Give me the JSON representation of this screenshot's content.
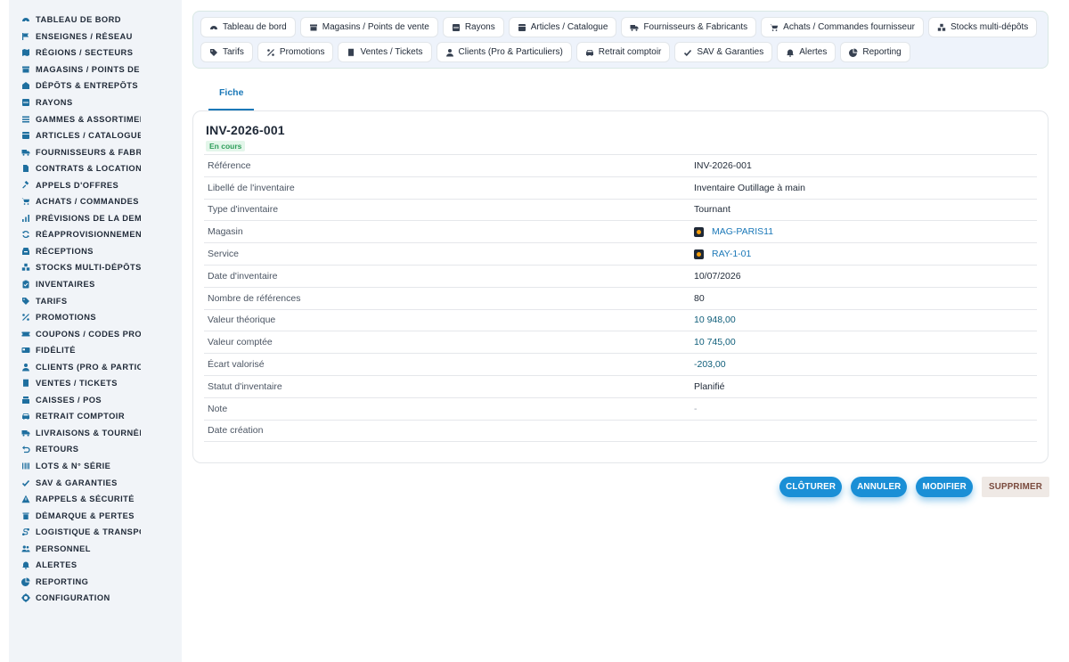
{
  "colors": {
    "accent": "#1a78b8",
    "button": "#1a8fd6",
    "badge_bg": "#e3f6ea",
    "badge_text": "#2d9d59",
    "danger_bg": "#efe9e5"
  },
  "sidebar": {
    "items": [
      {
        "label": "TABLEAU DE BORD",
        "icon": "dashboard-icon"
      },
      {
        "label": "ENSEIGNES / RÉSEAU",
        "icon": "flag-icon"
      },
      {
        "label": "RÉGIONS / SECTEURS",
        "icon": "map-icon"
      },
      {
        "label": "MAGASINS / POINTS DE VENTE",
        "icon": "store-icon"
      },
      {
        "label": "DÉPÔTS & ENTREPÔTS",
        "icon": "warehouse-icon"
      },
      {
        "label": "RAYONS",
        "icon": "shelf-icon"
      },
      {
        "label": "GAMMES & ASSORTIMENTS",
        "icon": "list-icon"
      },
      {
        "label": "ARTICLES / CATALOGUE",
        "icon": "grid-icon"
      },
      {
        "label": "FOURNISSEURS & FABRICANTS",
        "icon": "truck-icon"
      },
      {
        "label": "CONTRATS & LOCATION",
        "icon": "document-icon"
      },
      {
        "label": "APPELS D'OFFRES",
        "icon": "gavel-icon"
      },
      {
        "label": "ACHATS / COMMANDES FOURNISSEUR",
        "icon": "cart-icon"
      },
      {
        "label": "PRÉVISIONS DE LA DEMANDE",
        "icon": "chart-icon"
      },
      {
        "label": "RÉAPPROVISIONNEMENT",
        "icon": "refresh-icon"
      },
      {
        "label": "RÉCEPTIONS",
        "icon": "inbox-icon"
      },
      {
        "label": "STOCKS MULTI-DÉPÔTS",
        "icon": "boxes-icon"
      },
      {
        "label": "INVENTAIRES",
        "icon": "clipboard-icon"
      },
      {
        "label": "TARIFS",
        "icon": "tag-icon"
      },
      {
        "label": "PROMOTIONS",
        "icon": "percent-icon"
      },
      {
        "label": "COUPONS / CODES PROMO",
        "icon": "ticket-icon"
      },
      {
        "label": "FIDÉLITÉ",
        "icon": "card-icon"
      },
      {
        "label": "CLIENTS (PRO & PARTICULIERS)",
        "icon": "user-icon"
      },
      {
        "label": "VENTES / TICKETS",
        "icon": "receipt-icon"
      },
      {
        "label": "CAISSES / POS",
        "icon": "register-icon"
      },
      {
        "label": "RETRAIT COMPTOIR",
        "icon": "car-icon"
      },
      {
        "label": "LIVRAISONS & TOURNÉES",
        "icon": "delivery-icon"
      },
      {
        "label": "RETOURS",
        "icon": "undo-icon"
      },
      {
        "label": "LOTS & N° SÉRIE",
        "icon": "barcode-icon"
      },
      {
        "label": "SAV & GARANTIES",
        "icon": "check-shield-icon"
      },
      {
        "label": "RAPPELS & SÉCURITÉ",
        "icon": "warning-icon"
      },
      {
        "label": "DÉMARQUE & PERTES",
        "icon": "trash-icon"
      },
      {
        "label": "LOGISTIQUE & TRANSPORT",
        "icon": "route-icon"
      },
      {
        "label": "PERSONNEL",
        "icon": "users-icon"
      },
      {
        "label": "ALERTES",
        "icon": "bell-icon"
      },
      {
        "label": "REPORTING",
        "icon": "pie-icon"
      },
      {
        "label": "CONFIGURATION",
        "icon": "gear-icon"
      }
    ]
  },
  "topnav": {
    "chips": [
      {
        "label": "Tableau de bord",
        "icon": "dashboard-icon"
      },
      {
        "label": "Magasins / Points de vente",
        "icon": "store-icon"
      },
      {
        "label": "Rayons",
        "icon": "shelf-icon"
      },
      {
        "label": "Articles / Catalogue",
        "icon": "grid-icon"
      },
      {
        "label": "Fournisseurs & Fabricants",
        "icon": "truck-icon"
      },
      {
        "label": "Achats / Commandes fournisseur",
        "icon": "cart-icon"
      },
      {
        "label": "Stocks multi-dépôts",
        "icon": "boxes-icon"
      },
      {
        "label": "Tarifs",
        "icon": "tag-icon"
      },
      {
        "label": "Promotions",
        "icon": "percent-icon"
      },
      {
        "label": "Ventes / Tickets",
        "icon": "receipt-icon"
      },
      {
        "label": "Clients (Pro & Particuliers)",
        "icon": "user-icon"
      },
      {
        "label": "Retrait comptoir",
        "icon": "car-icon"
      },
      {
        "label": "SAV & Garanties",
        "icon": "check-shield-icon"
      },
      {
        "label": "Alertes",
        "icon": "bell-icon"
      },
      {
        "label": "Reporting",
        "icon": "pie-icon"
      }
    ]
  },
  "tabs": {
    "fiche": "Fiche"
  },
  "record": {
    "title": "INV-2026-001",
    "status_badge": "En cours",
    "fields": [
      {
        "key": "Référence",
        "value": "INV-2026-001",
        "kind": "text"
      },
      {
        "key": "Libellé de l'inventaire",
        "value": "Inventaire Outillage à main",
        "kind": "text"
      },
      {
        "key": "Type d'inventaire",
        "value": "Tournant",
        "kind": "text"
      },
      {
        "key": "Magasin",
        "value": "MAG-PARIS11",
        "kind": "link"
      },
      {
        "key": "Service",
        "value": "RAY-1-01",
        "kind": "link"
      },
      {
        "key": "Date d'inventaire",
        "value": "10/07/2026",
        "kind": "text"
      },
      {
        "key": "Nombre de références",
        "value": "80",
        "kind": "text"
      },
      {
        "key": "Valeur théorique",
        "value": "10 948,00",
        "kind": "num"
      },
      {
        "key": "Valeur comptée",
        "value": "10 745,00",
        "kind": "num"
      },
      {
        "key": "Écart valorisé",
        "value": "-203,00",
        "kind": "num"
      },
      {
        "key": "Statut d'inventaire",
        "value": "Planifié",
        "kind": "text"
      },
      {
        "key": "Note",
        "value": "-",
        "kind": "muted"
      },
      {
        "key": "Date création",
        "value": "",
        "kind": "text"
      }
    ]
  },
  "actions": {
    "close": "CLÔTURER",
    "cancel": "ANNULER",
    "edit": "MODIFIER",
    "delete": "SUPPRIMER"
  }
}
